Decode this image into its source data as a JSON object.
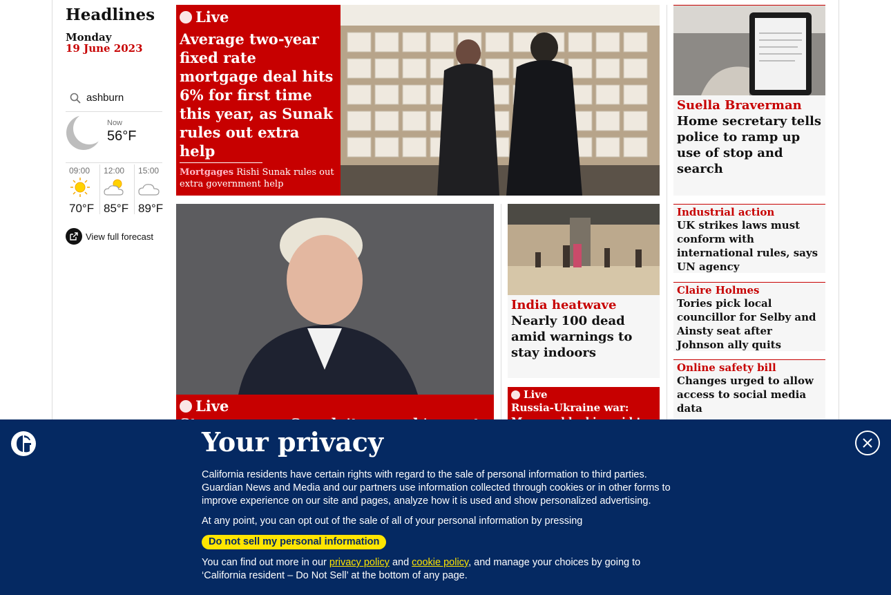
{
  "section": {
    "title": "Headlines",
    "day": "Monday",
    "date": "19 June 2023"
  },
  "weather": {
    "location": "ashburn",
    "now_label": "Now",
    "now_temp": "56°F",
    "now_icon": "moon-icon",
    "forecast": [
      {
        "time": "09:00",
        "temp": "70°F",
        "icon": "sun-icon"
      },
      {
        "time": "12:00",
        "temp": "85°F",
        "icon": "sun-cloud-icon"
      },
      {
        "time": "15:00",
        "temp": "89°F",
        "icon": "cloud-icon"
      }
    ],
    "full_forecast_label": "View full forecast"
  },
  "lead": {
    "live_label": "Live",
    "headline": "Average two-year fixed rate mortgage deal hits 6% for first time this year, as Sunak rules out extra help",
    "sub_kicker": "Mortgages",
    "sub_text": "Rishi Sunak rules out extra government help"
  },
  "right_top": {
    "kicker": "Suella Braverman",
    "headline": "Home secretary tells police to ramp up use of stop and search"
  },
  "right_items": [
    {
      "kicker": "Industrial action",
      "headline": "UK strikes laws must conform with international rules, says UN agency"
    },
    {
      "kicker": "Claire Holmes",
      "headline": "Tories pick local councillor for Selby and Ainsty seat after Johnson ally quits"
    },
    {
      "kicker": "Online safety bill",
      "headline": "Changes urged to allow access to social media data"
    }
  ],
  "johnson": {
    "live_label": "Live",
    "headline": "Starmer says Sunak 'too weak' as vote on Johnson's conduct"
  },
  "india": {
    "kicker": "India heatwave",
    "headline": "Nearly 100 dead amid warnings to stay indoors"
  },
  "ukraine": {
    "live_label": "Live",
    "headline": "Russia-Ukraine war: Moscow blocking aid to"
  },
  "privacy": {
    "title": "Your privacy",
    "p1": "California residents have certain rights with regard to the sale of personal information to third parties. Guardian News and Media and our partners use information collected through cookies or in other forms to improve experience on our site and pages, analyze how it is used and show personalized advertising.",
    "p2": "At any point, you can opt out of the sale of all of your personal information by pressing",
    "dns_button": "Do not sell my personal information",
    "p3_a": "You can find out more in our",
    "privacy_link": "privacy policy",
    "and": "and",
    "cookie_link": "cookie policy",
    "p3_b": ", and manage your choices by going to ‘California resident – Do Not Sell’ at the bottom of any page."
  }
}
